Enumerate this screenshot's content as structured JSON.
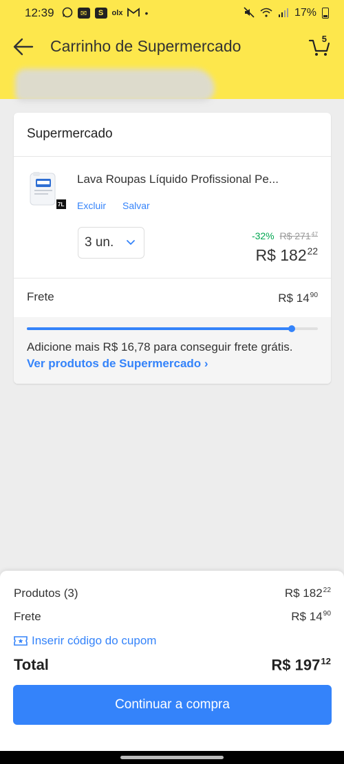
{
  "status_bar": {
    "time": "12:39",
    "battery": "17%",
    "icons": [
      "whatsapp-icon",
      "mail-icon",
      "s-app-icon",
      "olx-icon",
      "gmail-icon",
      "dot-icon",
      "mute-icon",
      "wifi-icon",
      "signal-icon",
      "battery-icon"
    ]
  },
  "header": {
    "title": "Carrinho de Supermercado",
    "cart_count": "5"
  },
  "card": {
    "title": "Supermercado",
    "product": {
      "name": "Lava Roupas Líquido Profissional Pe...",
      "thumb_label": "7L",
      "delete_label": "Excluir",
      "save_label": "Salvar",
      "quantity": "3 un.",
      "discount": "-32%",
      "old_price": "R$ 271",
      "old_price_cents": "47",
      "price": "R$ 182",
      "price_cents": "22"
    },
    "shipping": {
      "label": "Frete",
      "price": "R$ 14",
      "price_cents": "90",
      "progress": 0.91,
      "message": "Adicione mais R$ 16,78 para conseguir frete grátis.",
      "link": "Ver produtos de Supermercado ›"
    }
  },
  "summary": {
    "products_label": "Produtos (3)",
    "products_price": "R$ 182",
    "products_cents": "22",
    "shipping_label": "Frete",
    "shipping_price": "R$ 14",
    "shipping_cents": "90",
    "coupon_label": "Inserir código do cupom",
    "total_label": "Total",
    "total_price": "R$ 197",
    "total_cents": "12",
    "continue_label": "Continuar a compra"
  },
  "colors": {
    "brand_yellow": "#fde74c",
    "accent_blue": "#3483fa",
    "discount_green": "#00a650"
  }
}
